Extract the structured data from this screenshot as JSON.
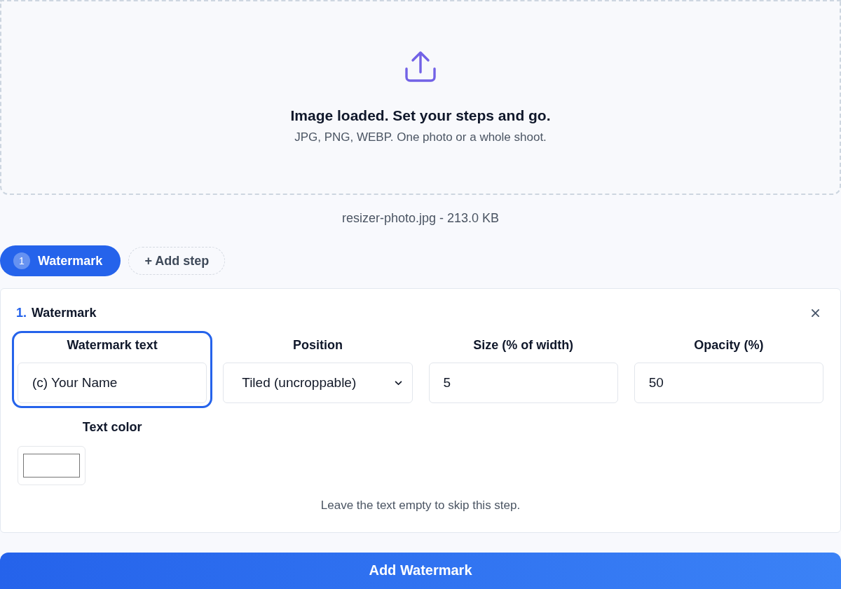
{
  "dropzone": {
    "title": "Image loaded. Set your steps and go.",
    "subtitle": "JPG, PNG, WEBP. One photo or a whole shoot."
  },
  "file_info": "resizer-photo.jpg - 213.0 KB",
  "step_tabs": [
    {
      "number": "1",
      "label": "Watermark",
      "selected": true
    }
  ],
  "add_step_button": "+ Add step",
  "step_panel": {
    "number": "1.",
    "title": "Watermark",
    "fields": [
      {
        "kind": "text",
        "label": "Watermark text",
        "value": "(c) Your Name",
        "focused": true
      },
      {
        "kind": "select",
        "label": "Position",
        "value": "Tiled (uncroppable)",
        "focused": false
      },
      {
        "kind": "number",
        "label": "Size (% of width)",
        "value": "5",
        "focused": false
      },
      {
        "kind": "number",
        "label": "Opacity (%)",
        "value": "50",
        "focused": false
      },
      {
        "kind": "color",
        "label": "Text color",
        "color": "#ffffff",
        "focused": false
      }
    ],
    "hint": "Leave the text empty to skip this step."
  },
  "submit_button": "Add Watermark"
}
